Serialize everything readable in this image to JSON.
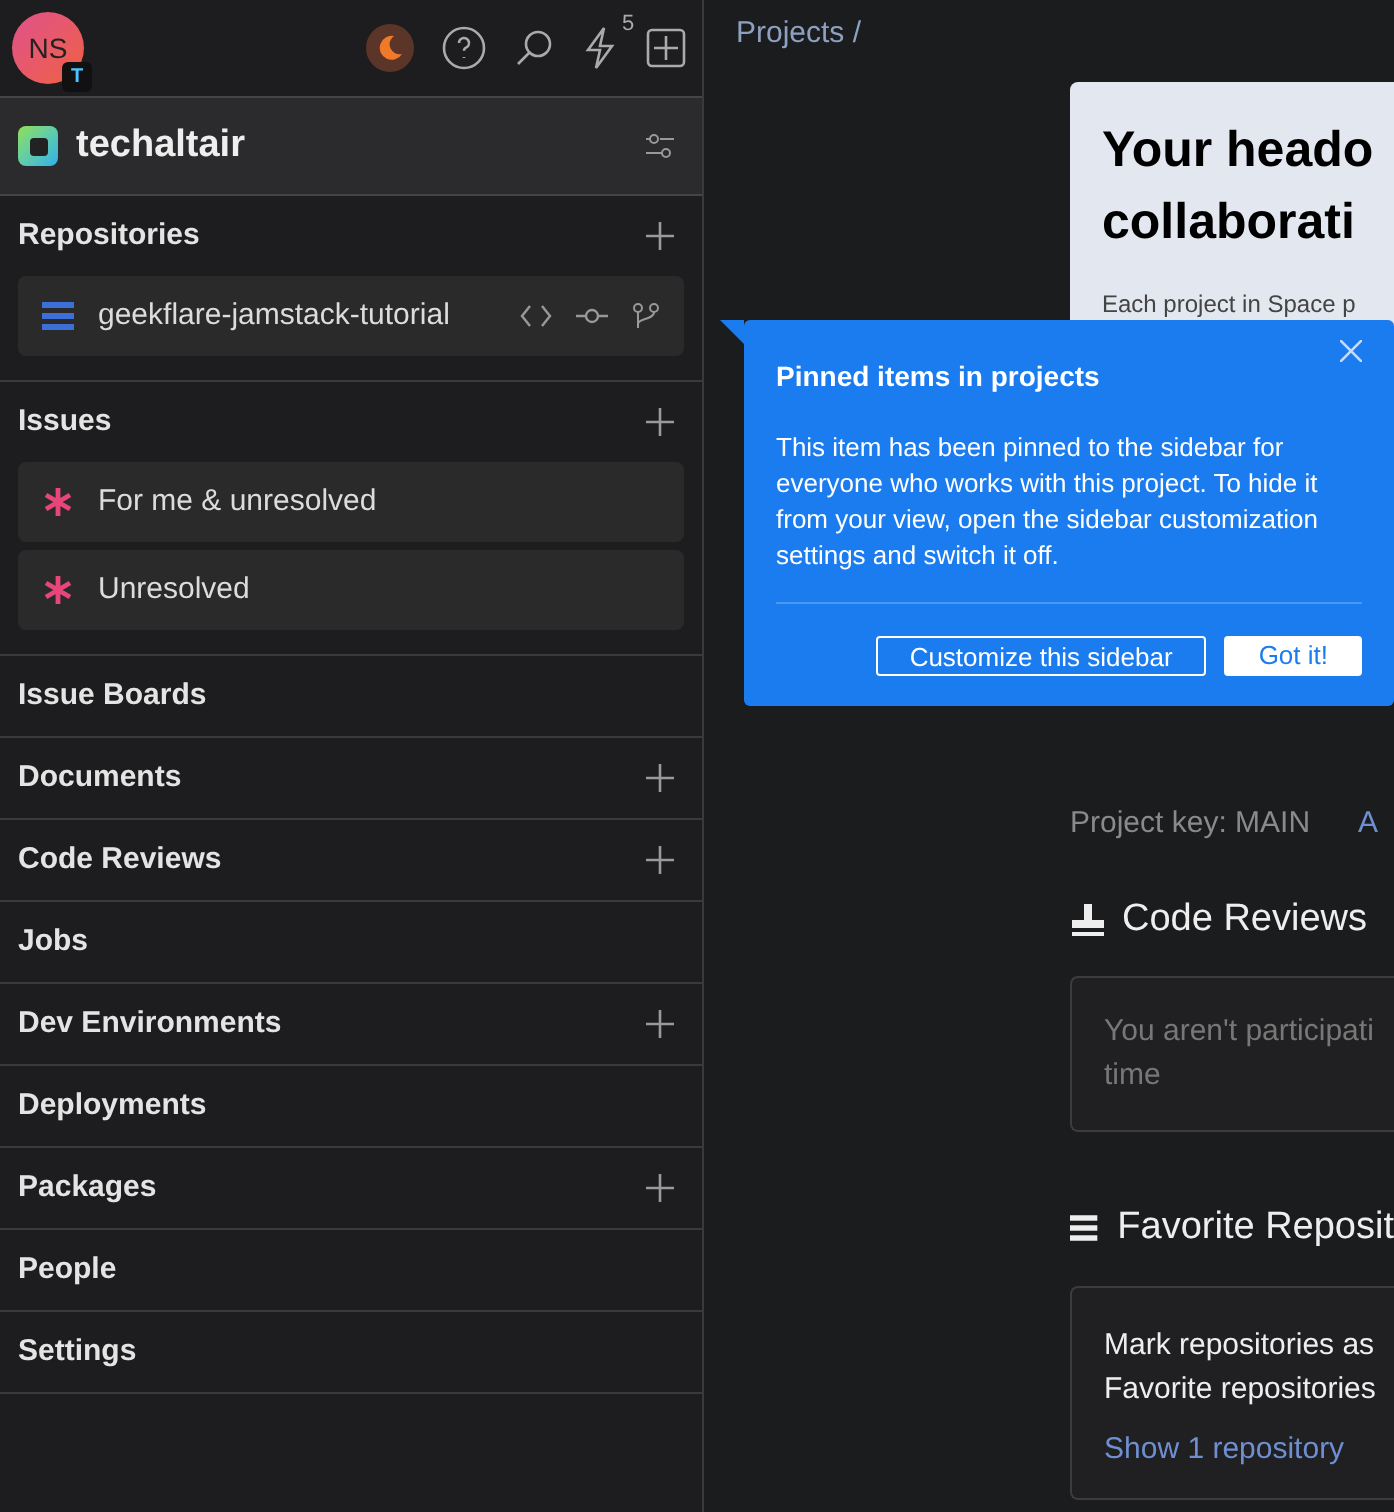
{
  "header": {
    "avatar": "NS",
    "badge": "T",
    "notifications": "5"
  },
  "workspace": {
    "name": "techaltair"
  },
  "sections": [
    {
      "title": "Repositories",
      "addable": true,
      "items": [
        {
          "kind": "repo",
          "label": "geekflare-jamstack-tutorial"
        }
      ]
    },
    {
      "title": "Issues",
      "addable": true,
      "items": [
        {
          "kind": "issue",
          "label": "For me & unresolved"
        },
        {
          "kind": "issue",
          "label": "Unresolved"
        }
      ]
    },
    {
      "title": "Issue Boards",
      "addable": false
    },
    {
      "title": "Documents",
      "addable": true
    },
    {
      "title": "Code Reviews",
      "addable": true
    },
    {
      "title": "Jobs",
      "addable": false
    },
    {
      "title": "Dev Environments",
      "addable": true
    },
    {
      "title": "Deployments",
      "addable": false
    },
    {
      "title": "Packages",
      "addable": true
    },
    {
      "title": "People",
      "addable": false
    },
    {
      "title": "Settings",
      "addable": false
    }
  ],
  "breadcrumb": "Projects /",
  "banner": {
    "title_lines": [
      "Your heado",
      "collaborati"
    ],
    "text": "Each project in Space p"
  },
  "project_key": "Project key: MAIN",
  "project_link": "A",
  "code_reviews": {
    "title": "Code Reviews",
    "lines": [
      "You aren't participati",
      "time"
    ]
  },
  "favorites": {
    "title": "Favorite Reposit",
    "lines": [
      "Mark repositories as",
      "Favorite repositories"
    ],
    "link": "Show 1 repository"
  },
  "popover": {
    "title": "Pinned items in projects",
    "text": "This item has been pinned to the sidebar for everyone who works with this project. To hide it from your view, open the sidebar customization settings and switch it off.",
    "buttons": [
      {
        "kind": "outline",
        "label": "Customize this sidebar"
      },
      {
        "kind": "solid",
        "label": "Got it!"
      }
    ]
  }
}
